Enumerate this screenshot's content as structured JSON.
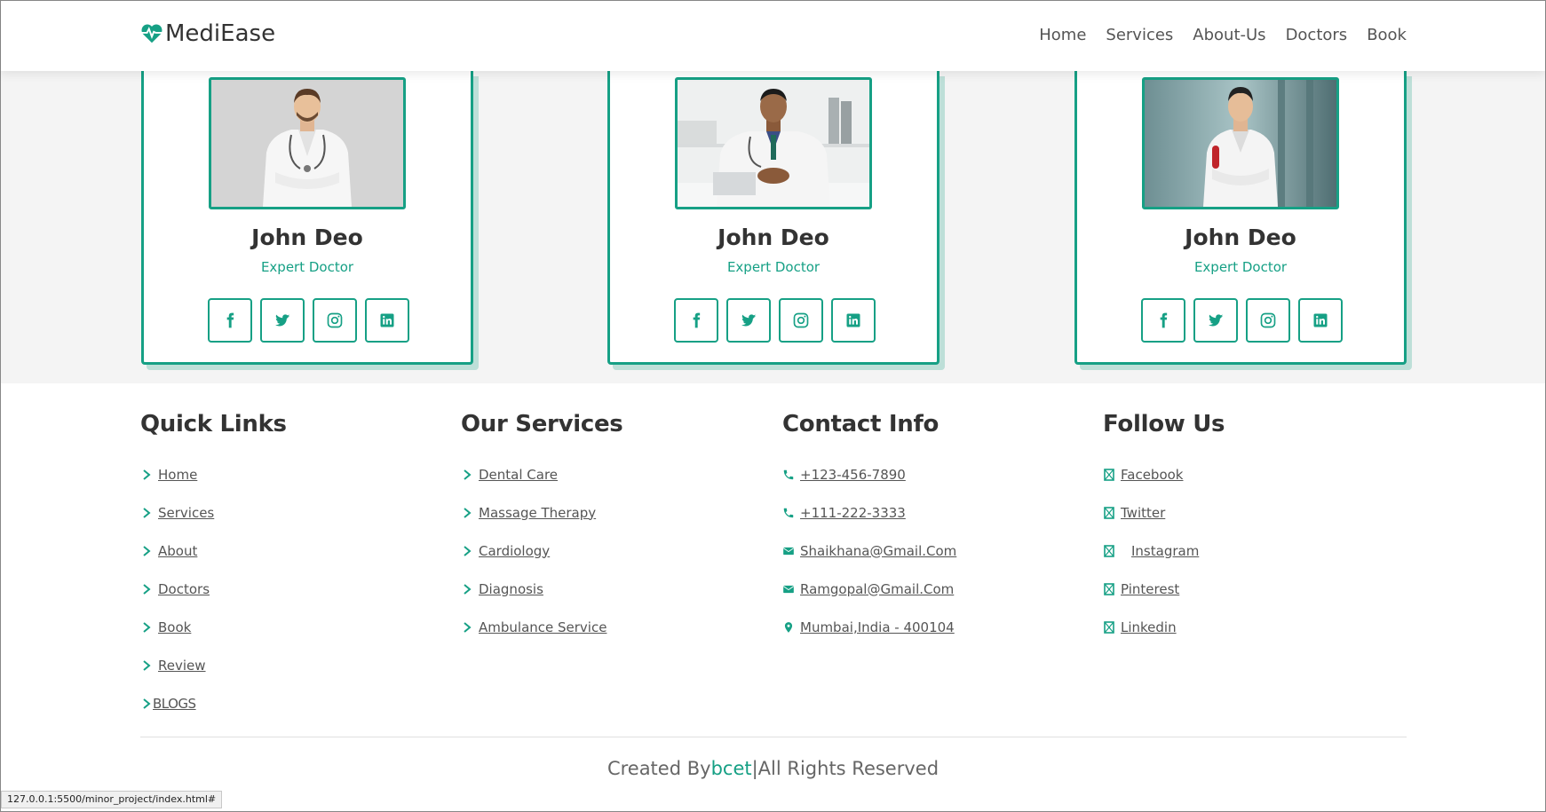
{
  "header": {
    "brand": "MediEase",
    "nav": [
      "Home",
      "Services",
      "About-Us",
      "Doctors",
      "Book"
    ]
  },
  "doctors": [
    {
      "name": "John Deo",
      "role": "Expert Doctor"
    },
    {
      "name": "John Deo",
      "role": "Expert Doctor"
    },
    {
      "name": "John Deo",
      "role": "Expert Doctor"
    }
  ],
  "footer": {
    "quick_links": {
      "title": "Quick Links",
      "items": [
        "Home",
        "Services",
        "About",
        "Doctors",
        "Book",
        "Review"
      ],
      "blogs": "BLOGS"
    },
    "services": {
      "title": "Our Services",
      "items": [
        "Dental Care",
        "Massage Therapy",
        "Cardiology",
        "Diagnosis",
        "Ambulance Service"
      ]
    },
    "contact": {
      "title": "Contact Info",
      "phone1": "+123-456-7890",
      "phone2": "+111-222-3333",
      "email1": "Shaikhana@Gmail.Com",
      "email2": "Ramgopal@Gmail.Com",
      "address": "Mumbai,India - 400104"
    },
    "follow": {
      "title": "Follow Us",
      "items": [
        "Facebook",
        "Twitter",
        "Instagram",
        "Pinterest",
        "Linkedin"
      ]
    },
    "credit": {
      "prefix": "Created By",
      "brand": "bcet",
      "suffix": "|All Rights Reserved"
    }
  },
  "status_url": "127.0.0.1:5500/minor_project/index.html#",
  "colors": {
    "accent": "#16a085",
    "text": "#444444",
    "section_bg": "#f4f4f4"
  }
}
